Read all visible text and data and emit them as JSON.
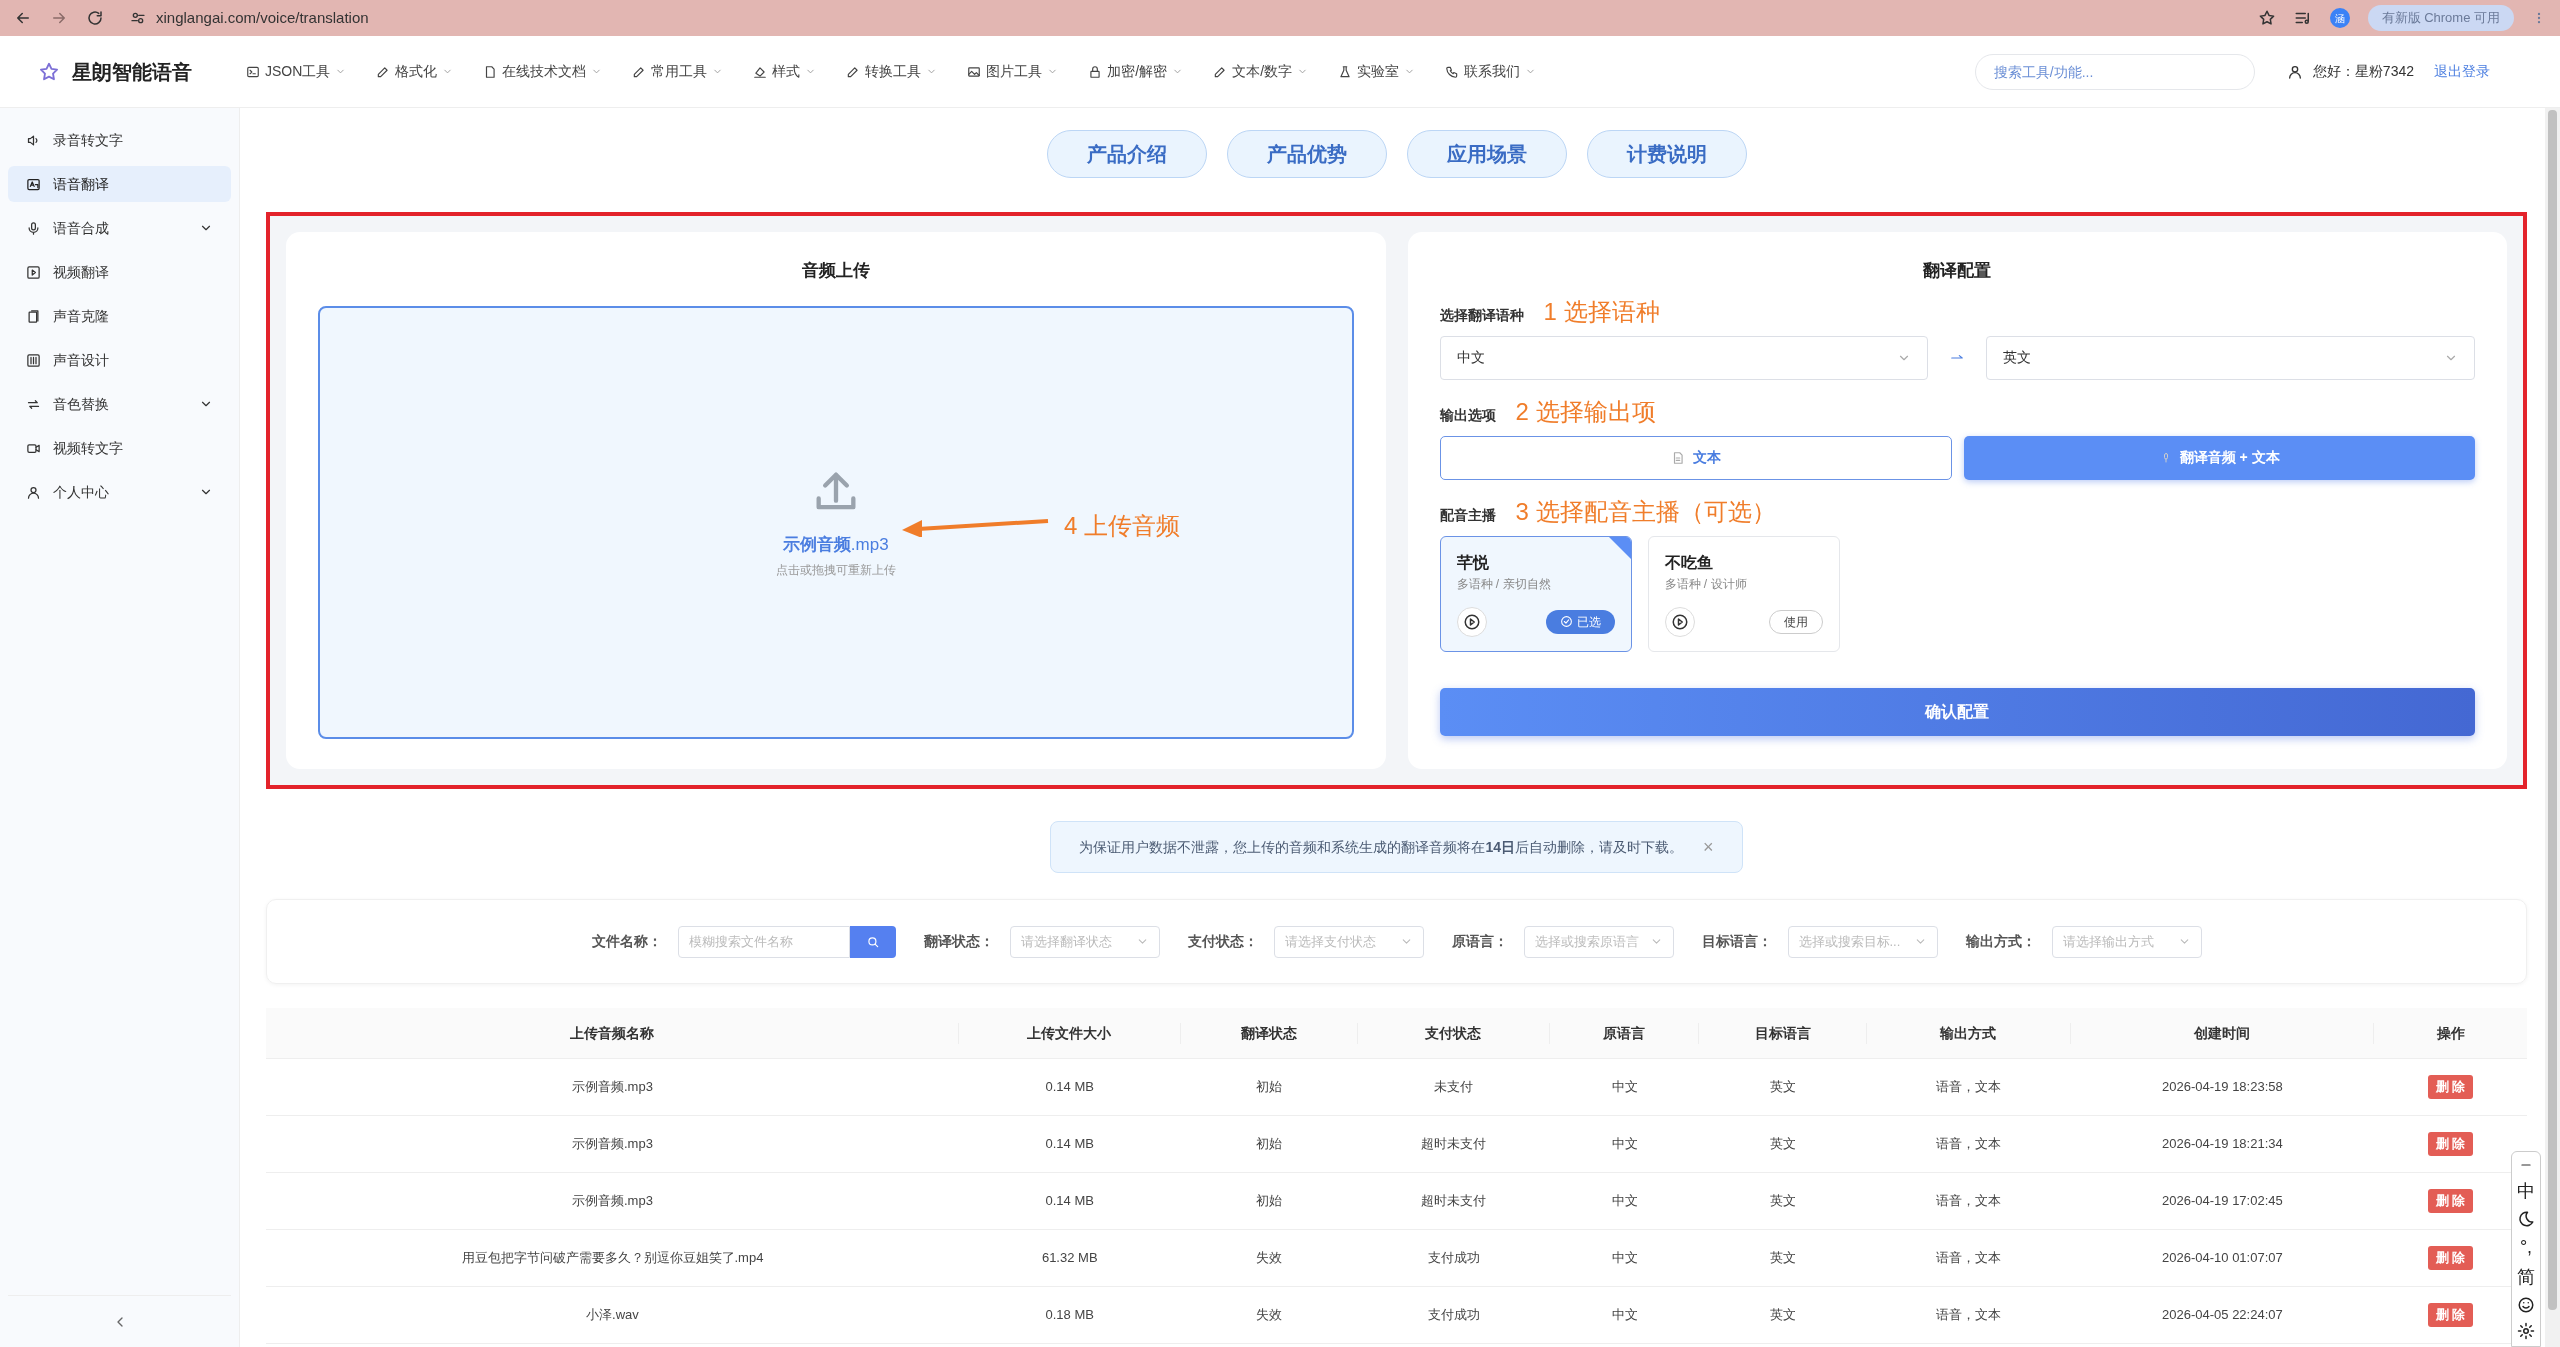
{
  "browser": {
    "url": "xinglangai.com/voice/translation",
    "update_notice": "有新版 Chrome 可用",
    "profile_badge": "涵"
  },
  "header": {
    "brand": "星朗智能语音",
    "nav": [
      {
        "label": "JSON工具"
      },
      {
        "label": "格式化"
      },
      {
        "label": "在线技术文档"
      },
      {
        "label": "常用工具"
      },
      {
        "label": "样式"
      },
      {
        "label": "转换工具"
      },
      {
        "label": "图片工具"
      },
      {
        "label": "加密/解密"
      },
      {
        "label": "文本/数字"
      },
      {
        "label": "实验室"
      },
      {
        "label": "联系我们"
      }
    ],
    "search": {
      "placeholder": "搜索工具/功能..."
    },
    "greeting": "您好：星粉7342",
    "logout": "退出登录"
  },
  "sidebar": {
    "items": [
      {
        "label": "录音转文字",
        "selected": false,
        "has_submenu": false
      },
      {
        "label": "语音翻译",
        "selected": true,
        "has_submenu": false
      },
      {
        "label": "语音合成",
        "selected": false,
        "has_submenu": true
      },
      {
        "label": "视频翻译",
        "selected": false,
        "has_submenu": false
      },
      {
        "label": "声音克隆",
        "selected": false,
        "has_submenu": false
      },
      {
        "label": "声音设计",
        "selected": false,
        "has_submenu": false
      },
      {
        "label": "音色替换",
        "selected": false,
        "has_submenu": true
      },
      {
        "label": "视频转文字",
        "selected": false,
        "has_submenu": false
      },
      {
        "label": "个人中心",
        "selected": false,
        "has_submenu": true
      }
    ]
  },
  "top_tabs": [
    "产品介绍",
    "产品优势",
    "应用场景",
    "计费说明"
  ],
  "upload_panel": {
    "title": "音频上传",
    "file_name": "示例音频",
    "file_ext": ".mp3",
    "hint": "点击或拖拽可重新上传",
    "annotation": "4 上传音频"
  },
  "config_panel": {
    "title": "翻译配置",
    "language": {
      "label": "选择翻译语种",
      "annotation": "1 选择语种",
      "source": "中文",
      "target": "英文"
    },
    "output": {
      "label": "输出选项",
      "annotation": "2 选择输出项",
      "options": [
        {
          "label": "文本",
          "selected": false
        },
        {
          "label": "翻译音频 + 文本",
          "selected": true
        }
      ]
    },
    "voice": {
      "label": "配音主播",
      "annotation": "3 选择配音主播（可选）",
      "voices": [
        {
          "name": "芊悦",
          "desc": "多语种 / 亲切自然",
          "action": "已选",
          "selected": true
        },
        {
          "name": "不吃鱼",
          "desc": "多语种 / 设计师",
          "action": "使用",
          "selected": false
        }
      ]
    },
    "confirm": "确认配置"
  },
  "notice": {
    "text": "为保证用户数据不泄露，您上传的音频和系统生成的翻译音频将在**14日**后自动删除，请及时下载。",
    "close": "×"
  },
  "filters": [
    {
      "label": "文件名称：",
      "placeholder": "模糊搜索文件名称",
      "kind": "search"
    },
    {
      "label": "翻译状态：",
      "placeholder": "请选择翻译状态",
      "kind": "select"
    },
    {
      "label": "支付状态：",
      "placeholder": "请选择支付状态",
      "kind": "select"
    },
    {
      "label": "原语言：",
      "placeholder": "选择或搜索原语言",
      "kind": "select"
    },
    {
      "label": "目标语言：",
      "placeholder": "选择或搜索目标...",
      "kind": "select"
    },
    {
      "label": "输出方式：",
      "placeholder": "请选择输出方式",
      "kind": "select"
    }
  ],
  "table": {
    "columns": [
      "上传音频名称",
      "上传文件大小",
      "翻译状态",
      "支付状态",
      "原语言",
      "目标语言",
      "输出方式",
      "创建时间",
      "操作"
    ],
    "rows": [
      [
        "示例音频.mp3",
        "0.14 MB",
        "初始",
        "未支付",
        "中文",
        "英文",
        "语音，文本",
        "2026-04-19 18:23:58",
        "删 除"
      ],
      [
        "示例音频.mp3",
        "0.14 MB",
        "初始",
        "超时未支付",
        "中文",
        "英文",
        "语音，文本",
        "2026-04-19 18:21:34",
        "删 除"
      ],
      [
        "示例音频.mp3",
        "0.14 MB",
        "初始",
        "超时未支付",
        "中文",
        "英文",
        "语音，文本",
        "2026-04-19 17:02:45",
        "删 除"
      ],
      [
        "用豆包把字节问破产需要多久？别逗你豆姐笑了.mp4",
        "61.32 MB",
        "失效",
        "支付成功",
        "中文",
        "英文",
        "语音，文本",
        "2026-04-10 01:07:07",
        "删 除"
      ],
      [
        "小泽.wav",
        "0.18 MB",
        "失效",
        "支付成功",
        "中文",
        "英文",
        "语音，文本",
        "2026-04-05 22:24:07",
        "删 除"
      ]
    ]
  },
  "ime_toolbar": [
    {
      "kind": "minimize"
    },
    {
      "kind": "text",
      "label": "中"
    },
    {
      "kind": "moon"
    },
    {
      "kind": "text",
      "label": "°,"
    },
    {
      "kind": "text",
      "label": "简"
    },
    {
      "kind": "smiley"
    },
    {
      "kind": "gear"
    }
  ]
}
